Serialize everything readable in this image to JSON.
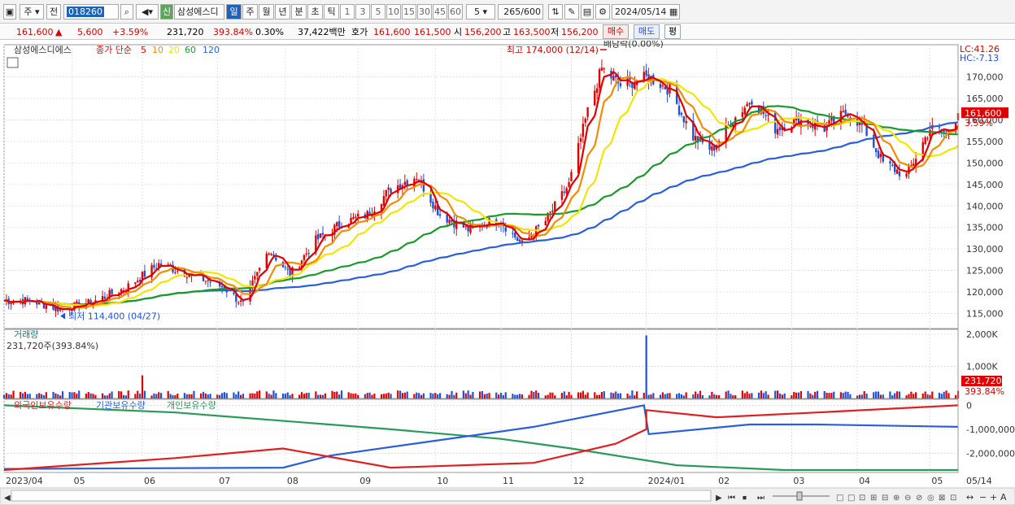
{
  "toolbar": {
    "type_label": "주",
    "prev_label": "전",
    "code": "018260",
    "new_badge": "신",
    "name": "삼성에스디",
    "periods": [
      "일",
      "주",
      "월",
      "년",
      "분",
      "초",
      "틱"
    ],
    "intervals": [
      "1",
      "3",
      "5",
      "10",
      "15",
      "30",
      "45",
      "60"
    ],
    "interval_value": "5",
    "count": "265",
    "count_max": "/600",
    "date": "2024/05/14"
  },
  "quote": {
    "price": "161,600",
    "arrow": "▲",
    "change": "5,600",
    "change_pct": "+3.59%",
    "volume": "231,720",
    "volume_ratio": "393.84%",
    "turnover_pct": "0.30%",
    "amount": "37,422백만",
    "bid_label": "호가",
    "ask": "161,600",
    "bid": "161,500",
    "open_label": "시",
    "open": "156,200",
    "high_label": "고",
    "high": "163,500",
    "low_label": "저",
    "low": "156,200",
    "buy_label": "매수",
    "sell_label": "매도",
    "eval_label": "평"
  },
  "colors": {
    "up": "#e00000",
    "down": "#1e50d8",
    "ma5": "#e00000",
    "ma10": "#f28c00",
    "ma20": "#f2e600",
    "ma60": "#1a9a2a",
    "ma120": "#2a5fd8",
    "foreign": "#e02020",
    "institution": "#2a5fd8",
    "individual": "#2a9a5a"
  },
  "chart_data": {
    "type": "candlestick",
    "price_panel": {
      "name": "삼성에스디에스",
      "ma_label": "종가 단순",
      "ma_periods": [
        "5",
        "10",
        "20",
        "60",
        "120"
      ],
      "y_ticks": [
        115000,
        120000,
        125000,
        130000,
        135000,
        140000,
        145000,
        150000,
        155000,
        160000,
        165000,
        170000
      ],
      "y_tick_labels": [
        "115,000",
        "120,000",
        "125,000",
        "130,000",
        "135,000",
        "140,000",
        "145,000",
        "150,000",
        "155,000",
        "160,000",
        "165,000",
        "170,000"
      ],
      "ylim": [
        111500,
        177500
      ],
      "lc": "LC:41.26",
      "hc": "HC:-7.13",
      "last_price": "161,600",
      "last_pct": "3.59%",
      "high_annotation": "최고 174,000 (12/14)",
      "low_annotation": "최저 114,400 (04/27)",
      "dividend_annotation": "배당락(0.00%)",
      "close_keypoints": [
        [
          "2023-04-14",
          118000
        ],
        [
          "2023-04-27",
          116000
        ],
        [
          "2023-05-10",
          117500
        ],
        [
          "2023-05-25",
          121000
        ],
        [
          "2023-06-08",
          126500
        ],
        [
          "2023-06-22",
          124000
        ],
        [
          "2023-07-06",
          121000
        ],
        [
          "2023-07-14",
          117000
        ],
        [
          "2023-07-25",
          130000
        ],
        [
          "2023-08-03",
          124000
        ],
        [
          "2023-08-14",
          132000
        ],
        [
          "2023-08-25",
          136000
        ],
        [
          "2023-09-05",
          138000
        ],
        [
          "2023-09-15",
          144000
        ],
        [
          "2023-09-26",
          147000
        ],
        [
          "2023-10-06",
          138000
        ],
        [
          "2023-10-18",
          134500
        ],
        [
          "2023-10-31",
          137000
        ],
        [
          "2023-11-10",
          131000
        ],
        [
          "2023-11-20",
          136500
        ],
        [
          "2023-11-30",
          145000
        ],
        [
          "2023-12-08",
          162000
        ],
        [
          "2023-12-14",
          172000
        ],
        [
          "2023-12-22",
          168000
        ],
        [
          "2024-01-03",
          170000
        ],
        [
          "2024-01-12",
          167000
        ],
        [
          "2024-01-22",
          156000
        ],
        [
          "2024-01-30",
          153000
        ],
        [
          "2024-02-08",
          160000
        ],
        [
          "2024-02-16",
          165000
        ],
        [
          "2024-02-26",
          158000
        ],
        [
          "2024-03-07",
          160000
        ],
        [
          "2024-03-18",
          158000
        ],
        [
          "2024-03-28",
          162000
        ],
        [
          "2024-04-04",
          158000
        ],
        [
          "2024-04-12",
          150000
        ],
        [
          "2024-04-22",
          147000
        ],
        [
          "2024-05-02",
          158000
        ],
        [
          "2024-05-09",
          157000
        ],
        [
          "2024-05-14",
          161600
        ]
      ]
    },
    "volume_panel": {
      "label": "거래량",
      "current": "231,720주(393.84%)",
      "y_ticks": [
        1000000,
        2000000
      ],
      "y_tick_labels": [
        "1,000K",
        "2,000K"
      ],
      "last_volume": "231,720",
      "last_pct": "393.84%",
      "spikes": [
        [
          "2023-06-01",
          720000
        ],
        [
          "2024-01-02",
          1960000
        ]
      ]
    },
    "holdings_panel": {
      "series_names": [
        "외국인보유수량",
        "기관보유수량",
        "개인보유수량"
      ],
      "y_ticks": [
        0,
        -1000000,
        -2000000
      ],
      "y_tick_labels": [
        "0",
        "-1,000,000",
        "-2,000,000"
      ],
      "foreign": [
        [
          "2023-04-03",
          -2700000
        ],
        [
          "2023-06-15",
          -2200000
        ],
        [
          "2023-07-31",
          -1800000
        ],
        [
          "2023-09-15",
          -2600000
        ],
        [
          "2023-11-15",
          -2400000
        ],
        [
          "2023-12-20",
          -1600000
        ],
        [
          "2024-01-02",
          -1000000
        ],
        [
          "2024-01-02",
          -200000
        ],
        [
          "2024-02-01",
          -500000
        ],
        [
          "2024-03-15",
          -300000
        ],
        [
          "2024-05-14",
          0
        ]
      ],
      "institution": [
        [
          "2023-04-03",
          -2650000
        ],
        [
          "2023-07-31",
          -2600000
        ],
        [
          "2023-08-20",
          -2100000
        ],
        [
          "2023-09-25",
          -1600000
        ],
        [
          "2023-11-15",
          -900000
        ],
        [
          "2024-01-01",
          0
        ],
        [
          "2024-01-03",
          -1200000
        ],
        [
          "2024-02-15",
          -800000
        ],
        [
          "2024-03-15",
          -800000
        ],
        [
          "2024-05-14",
          -900000
        ]
      ],
      "individual": [
        [
          "2023-04-03",
          0
        ],
        [
          "2023-06-15",
          -300000
        ],
        [
          "2023-09-15",
          -1000000
        ],
        [
          "2023-11-01",
          -1400000
        ],
        [
          "2023-12-01",
          -1800000
        ],
        [
          "2024-01-15",
          -2500000
        ],
        [
          "2024-03-01",
          -2700000
        ],
        [
          "2024-05-14",
          -2700000
        ]
      ]
    },
    "x_tick_labels": [
      "2023/04",
      "05",
      "06",
      "07",
      "08",
      "09",
      "10",
      "11",
      "12",
      "2024/01",
      "02",
      "03",
      "04",
      "05",
      "05/14"
    ],
    "x_tick_dates": [
      "2023-04-03",
      "2023-05-02",
      "2023-06-01",
      "2023-07-03",
      "2023-08-01",
      "2023-09-01",
      "2023-10-04",
      "2023-11-01",
      "2023-12-01",
      "2024-01-02",
      "2024-02-01",
      "2024-03-04",
      "2024-04-01",
      "2024-05-02",
      "2024-05-14"
    ],
    "x_range": [
      "2023-04-03",
      "2024-05-14"
    ]
  }
}
